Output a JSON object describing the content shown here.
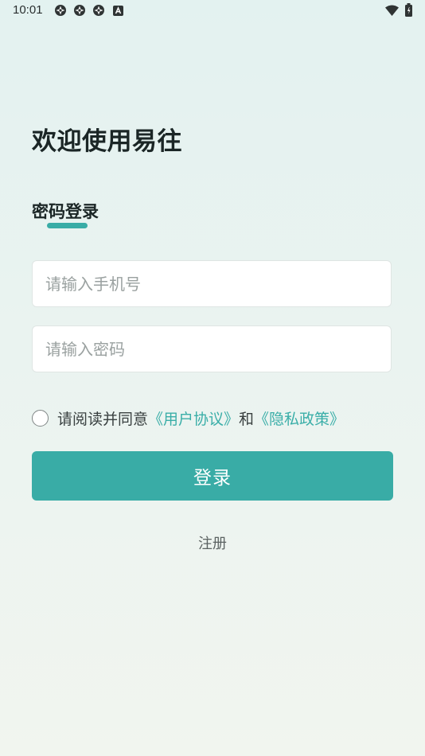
{
  "status_bar": {
    "time": "10:01",
    "left_icons": [
      "app-notification-icon",
      "app-notification-icon",
      "app-notification-icon",
      "a-badge-icon"
    ],
    "right_icons": [
      "wifi-icon",
      "battery-icon"
    ]
  },
  "header": {
    "title": "欢迎使用易往"
  },
  "tab": {
    "label": "密码登录"
  },
  "form": {
    "phone_placeholder": "请输入手机号",
    "phone_value": "",
    "password_placeholder": "请输入密码",
    "password_value": ""
  },
  "agreement": {
    "prefix": "请阅读并同意",
    "user_agreement": "《用户协议》",
    "conjunction": "和",
    "privacy_policy": "《隐私政策》",
    "checked": false
  },
  "actions": {
    "login_label": "登录",
    "register_label": "注册"
  },
  "colors": {
    "accent": "#39aca6",
    "link": "#3aaea8"
  }
}
